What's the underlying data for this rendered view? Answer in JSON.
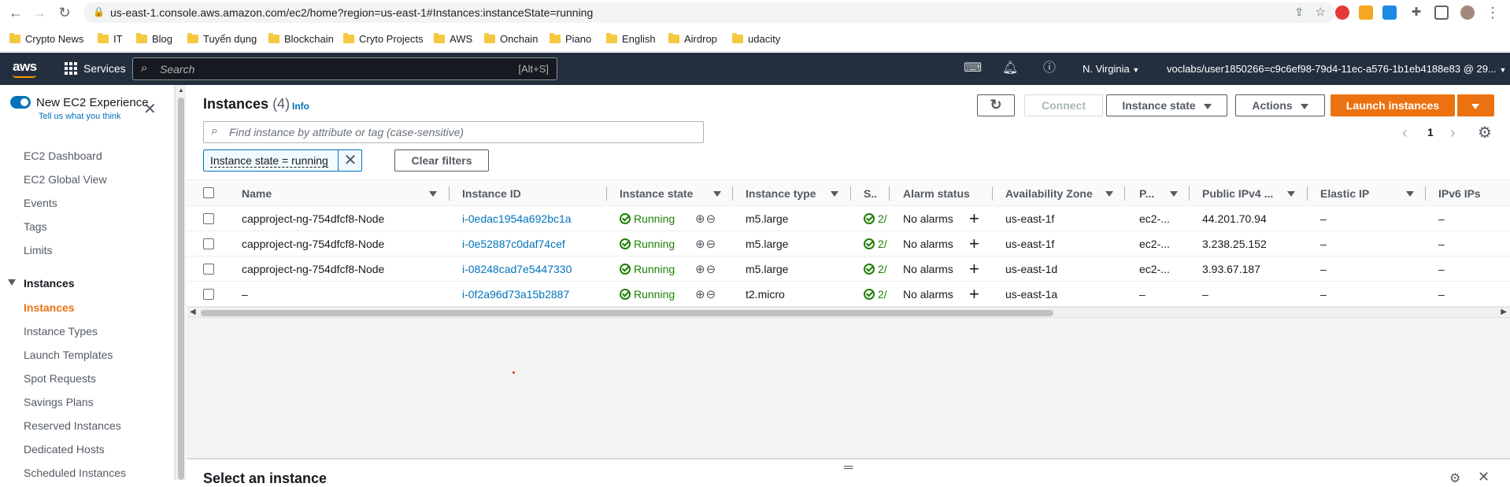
{
  "browser": {
    "url": "us-east-1.console.aws.amazon.com/ec2/home?region=us-east-1#Instances:instanceState=running",
    "bookmarks": [
      "Crypto News",
      "IT",
      "Blog",
      "Tuyển dụng",
      "Blockchain",
      "Cryto Projects",
      "AWS",
      "Onchain",
      "Piano",
      "English",
      "Airdrop",
      "udacity"
    ]
  },
  "topnav": {
    "logo": "aws",
    "services": "Services",
    "search_placeholder": "Search",
    "search_shortcut": "[Alt+S]",
    "region": "N. Virginia",
    "account": "voclabs/user1850266=c9c6ef98-79d4-11ec-a576-1b1eb4188e83 @ 29..."
  },
  "sidebar": {
    "new_experience": "New EC2 Experience",
    "tell_us": "Tell us what you think",
    "items_top": [
      "EC2 Dashboard",
      "EC2 Global View",
      "Events",
      "Tags",
      "Limits"
    ],
    "group": "Instances",
    "items_group": [
      "Instances",
      "Instance Types",
      "Launch Templates",
      "Spot Requests",
      "Savings Plans",
      "Reserved Instances",
      "Dedicated Hosts",
      "Scheduled Instances"
    ]
  },
  "main": {
    "title": "Instances",
    "count": "(4)",
    "info": "Info",
    "buttons": {
      "connect": "Connect",
      "instance_state": "Instance state",
      "actions": "Actions",
      "launch": "Launch instances"
    },
    "filter_placeholder": "Find instance by attribute or tag (case-sensitive)",
    "filter_token": "Instance state = running",
    "clear_filters": "Clear filters",
    "page": "1",
    "columns": [
      "Name",
      "Instance ID",
      "Instance state",
      "Instance type",
      "S..",
      "Alarm status",
      "Availability Zone",
      "P...",
      "Public IPv4 ...",
      "Elastic IP",
      "IPv6 IPs"
    ],
    "rows": [
      {
        "name": "capproject-ng-754dfcf8-Node",
        "id": "i-0edac1954a692bc1a",
        "state": "Running",
        "type": "m5.large",
        "checks": "2/",
        "alarm": "No alarms",
        "az": "us-east-1f",
        "dns": "ec2-...",
        "ipv4": "44.201.70.94",
        "eip": "–",
        "ipv6": "–"
      },
      {
        "name": "capproject-ng-754dfcf8-Node",
        "id": "i-0e52887c0daf74cef",
        "state": "Running",
        "type": "m5.large",
        "checks": "2/",
        "alarm": "No alarms",
        "az": "us-east-1f",
        "dns": "ec2-...",
        "ipv4": "3.238.25.152",
        "eip": "–",
        "ipv6": "–"
      },
      {
        "name": "capproject-ng-754dfcf8-Node",
        "id": "i-08248cad7e5447330",
        "state": "Running",
        "type": "m5.large",
        "checks": "2/",
        "alarm": "No alarms",
        "az": "us-east-1d",
        "dns": "ec2-...",
        "ipv4": "3.93.67.187",
        "eip": "–",
        "ipv6": "–"
      },
      {
        "name": "–",
        "id": "i-0f2a96d73a15b2887",
        "state": "Running",
        "type": "t2.micro",
        "checks": "2/",
        "alarm": "No alarms",
        "az": "us-east-1a",
        "dns": "–",
        "ipv4": "–",
        "eip": "–",
        "ipv6": "–"
      }
    ],
    "select_title": "Select an instance"
  },
  "colors": {
    "nav_bg": "#232f3e",
    "accent": "#ec7211",
    "link": "#0073bb",
    "running": "#1d8102"
  }
}
